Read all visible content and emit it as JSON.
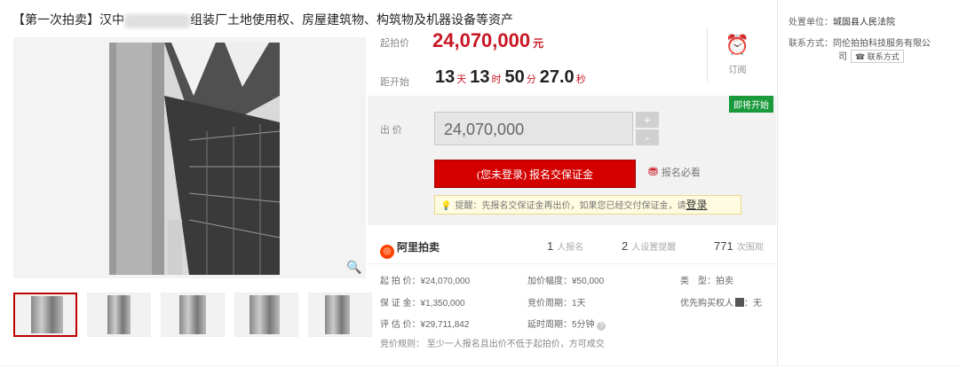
{
  "title": {
    "prefix": "【第一次拍卖】汉中",
    "suffix": "组装厂土地使用权、房屋建筑物、构筑物及机器设备等资产"
  },
  "price": {
    "start_label": "起拍价",
    "start_value": "24,070,000",
    "start_unit": "元",
    "countdown_label": "距开始",
    "days": "13",
    "days_unit": "天",
    "hours": "13",
    "hours_unit": "时",
    "minutes": "50",
    "minutes_unit": "分",
    "seconds": "27.0",
    "seconds_unit": "秒",
    "remind_label": "订阅"
  },
  "bid": {
    "badge": "即将开始",
    "label": "出 价",
    "input_value": "24,070,000",
    "plus": "+",
    "minus": "-",
    "signup_button": "(您未登录) 报名交保证金",
    "must_read": "报名必看",
    "tip_text": "提醒：先报名交保证金再出价，如果您已经交付保证金，请",
    "tip_login": "登录"
  },
  "stats": {
    "brand": "阿里拍卖",
    "applicants_num": "1",
    "applicants_label": "人报名",
    "reminders_num": "2",
    "reminders_label": "人设置提醒",
    "views_num": "771",
    "views_label": "次围观"
  },
  "details": {
    "start_price": "起 拍 价：¥24,070,000",
    "increment": "加价幅度：¥50,000",
    "type_label": "类　型：",
    "type_value": "拍卖",
    "deposit": "保 证 金：¥1,350,000",
    "period": "竞价周期：1天",
    "priority": "优先购买权人",
    "priority_value": "：无",
    "appraisal": "评 估 价：¥29,711,842",
    "delay": "延时周期：5分钟",
    "rules": "竞价规则：   至少一人报名且出价不低于起拍价，方可成交"
  },
  "sidebar": {
    "unit_label": "处置单位：",
    "unit_value": "城固县人民法院",
    "contact_label": "联系方式：",
    "contact_value_1": "同伦拍拍科技服务有限公",
    "contact_value_2": "司",
    "contact_button": "联系方式"
  },
  "colors": {
    "accent_red": "#c81623",
    "badge_green": "#1a9a3b",
    "tip_bg": "#fffbe0"
  }
}
